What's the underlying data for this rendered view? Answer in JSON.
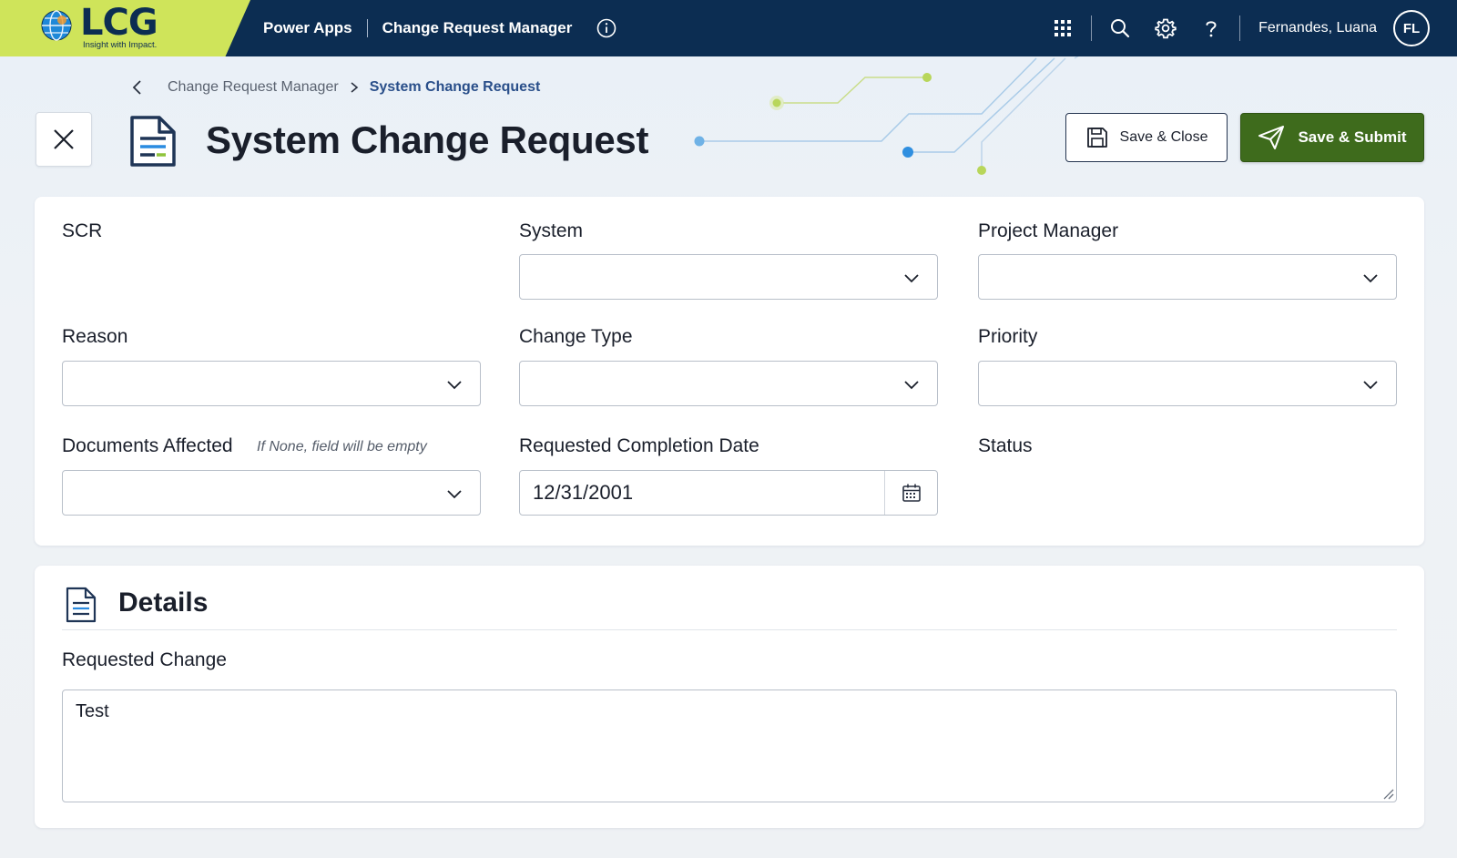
{
  "brand": {
    "name": "LCG",
    "tagline": "Insight with Impact."
  },
  "topbar": {
    "product": "Power Apps",
    "app_name": "Change Request Manager",
    "user_name": "Fernandes, Luana",
    "user_initials": "FL",
    "icons": [
      "waffle-icon",
      "search-icon",
      "gear-icon",
      "help-icon",
      "info-icon"
    ]
  },
  "breadcrumb": {
    "parent": "Change Request Manager",
    "current": "System Change Request"
  },
  "page": {
    "title": "System Change Request"
  },
  "actions": {
    "save_close": "Save & Close",
    "save_submit": "Save & Submit"
  },
  "form": {
    "scr_label": "SCR",
    "system_label": "System",
    "system_value": "",
    "pm_label": "Project Manager",
    "pm_value": "",
    "reason_label": "Reason",
    "reason_value": "",
    "change_type_label": "Change Type",
    "change_type_value": "",
    "priority_label": "Priority",
    "priority_value": "",
    "docs_label": "Documents Affected",
    "docs_hint": "If None, field will be empty",
    "docs_value": "",
    "date_label": "Requested Completion Date",
    "date_value": "12/31/2001",
    "status_label": "Status"
  },
  "details": {
    "title": "Details",
    "requested_change_label": "Requested Change",
    "requested_change_value": "Test"
  },
  "colors": {
    "topbar_bg": "#0c2d52",
    "brand_lime": "#cfe45a",
    "submit_green": "#3e6b1c",
    "breadcrumb_current": "#2a4f8a"
  }
}
